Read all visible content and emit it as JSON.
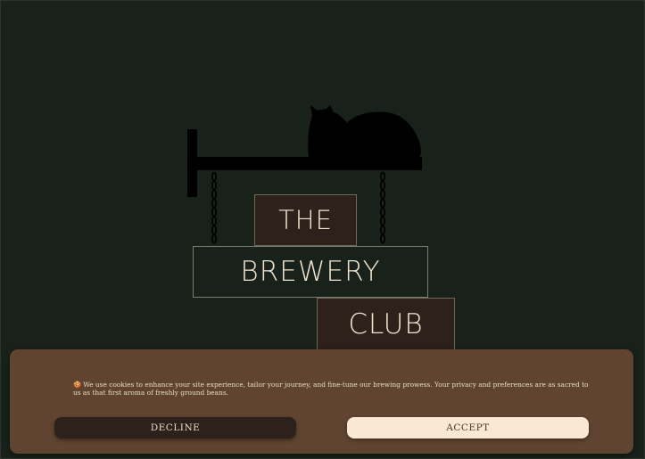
{
  "logo": {
    "lines": [
      "THE",
      "BREWERY",
      "CLUB"
    ],
    "icon": "cat-on-hanging-sign-bracket"
  },
  "cookie_banner": {
    "emoji": "🍪",
    "message": "We use cookies to enhance your site experience, tailor your journey, and fine-tune our brewing prowess. Your privacy and preferences are as sacred to us as that first aroma of freshly ground beans.",
    "decline_label": "DECLINE",
    "accept_label": "ACCEPT"
  },
  "colors": {
    "background": "#18221a",
    "sign_dark": "#2e211b",
    "sign_text": "#efe4cf",
    "banner": "#604431",
    "accept_button": "#fbe8d4",
    "decline_button": "#2e211b"
  }
}
